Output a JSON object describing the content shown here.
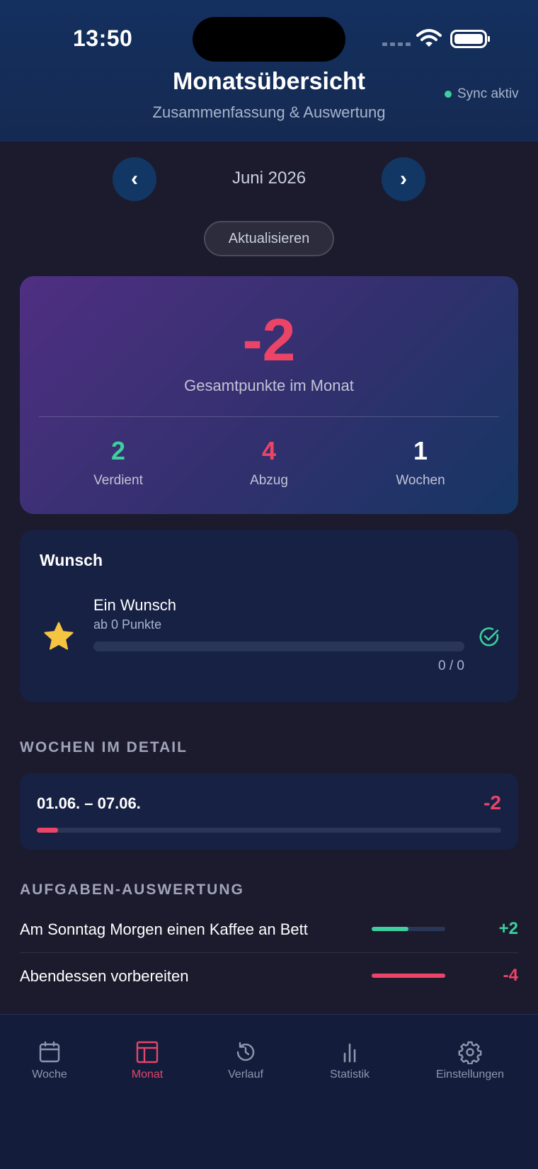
{
  "status_bar": {
    "time": "13:50"
  },
  "header": {
    "title": "Monatsübersicht",
    "subtitle": "Zusammenfassung & Auswertung",
    "sync_label": "Sync aktiv"
  },
  "month_nav": {
    "prev": "‹",
    "label": "Juni 2026",
    "next": "›"
  },
  "refresh_label": "Aktualisieren",
  "summary": {
    "total": "-2",
    "total_label": "Gesamtpunkte im Monat",
    "earned_value": "2",
    "earned_label": "Verdient",
    "deduction_value": "4",
    "deduction_label": "Abzug",
    "weeks_value": "1",
    "weeks_label": "Wochen"
  },
  "wish": {
    "section_title": "Wunsch",
    "name": "Ein Wunsch",
    "threshold": "ab 0 Punkte",
    "progress_text": "0 / 0",
    "progress": 0
  },
  "weeks_section": {
    "title": "WOCHEN IM DETAIL",
    "weeks": [
      {
        "range": "01.06. – 07.06.",
        "value": "-2",
        "progress": 0.045
      }
    ]
  },
  "tasks_section": {
    "title": "AUFGABEN-AUSWERTUNG",
    "tasks": [
      {
        "name": "Am Sonntag Morgen einen Kaffee an Bett",
        "value": "+2",
        "progress": 0.5
      },
      {
        "name": "Abendessen vorbereiten",
        "value": "-4",
        "progress": 1.0
      }
    ]
  },
  "tabbar": {
    "tabs": [
      {
        "label": "Woche",
        "icon": "calendar-icon"
      },
      {
        "label": "Monat",
        "icon": "month-layout-icon",
        "active": true
      },
      {
        "label": "Verlauf",
        "icon": "history-icon"
      },
      {
        "label": "Statistik",
        "icon": "bar-chart-icon"
      },
      {
        "label": "Einstellungen",
        "icon": "gear-icon"
      }
    ]
  },
  "colors": {
    "accent_red": "#ec4466",
    "accent_green": "#3ecf9e",
    "star": "#f5c542",
    "background": "#1c1b2e"
  }
}
